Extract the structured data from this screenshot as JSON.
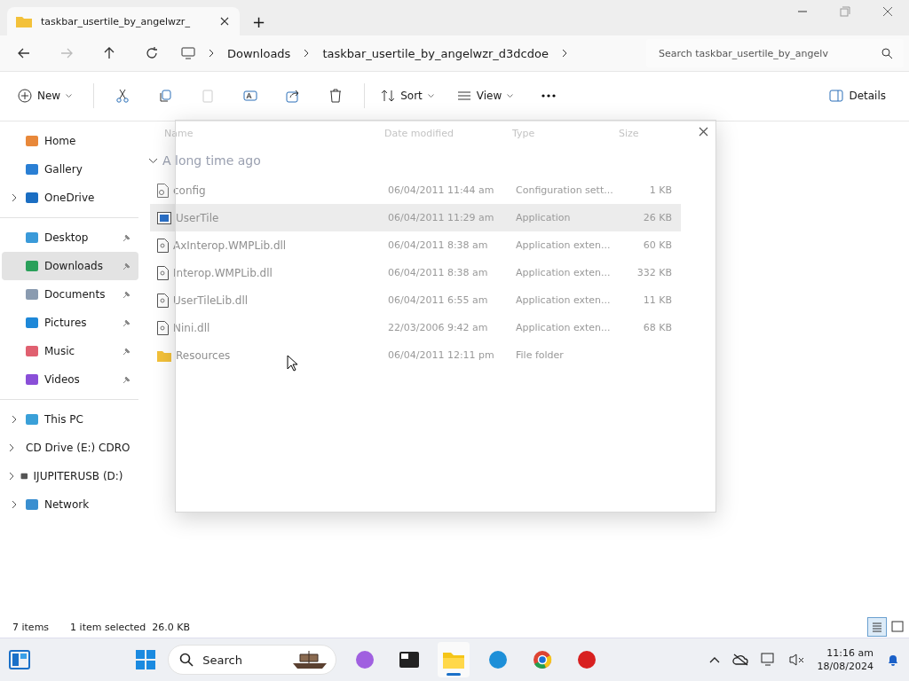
{
  "window": {
    "tab_title": "taskbar_usertile_by_angelwzr_",
    "new_tab": "+"
  },
  "address": {
    "crumbs": [
      "Downloads",
      "taskbar_usertile_by_angelwzr_d3dcdoe"
    ],
    "search_placeholder": "Search taskbar_usertile_by_angelv"
  },
  "toolbar": {
    "new": "New",
    "sort": "Sort",
    "view": "View",
    "details": "Details"
  },
  "sidebar": {
    "groups": [
      [
        {
          "label": "Home",
          "kind": "home",
          "expandable": false,
          "pinned": false,
          "selected": false
        },
        {
          "label": "Gallery",
          "kind": "gallery",
          "expandable": false,
          "pinned": false,
          "selected": false
        },
        {
          "label": "OneDrive",
          "kind": "cloud",
          "expandable": true,
          "pinned": false,
          "selected": false
        }
      ],
      [
        {
          "label": "Desktop",
          "kind": "desktop",
          "expandable": false,
          "pinned": true,
          "selected": false
        },
        {
          "label": "Downloads",
          "kind": "download",
          "expandable": false,
          "pinned": true,
          "selected": true
        },
        {
          "label": "Documents",
          "kind": "document",
          "expandable": false,
          "pinned": true,
          "selected": false
        },
        {
          "label": "Pictures",
          "kind": "pictures",
          "expandable": false,
          "pinned": true,
          "selected": false
        },
        {
          "label": "Music",
          "kind": "music",
          "expandable": false,
          "pinned": true,
          "selected": false
        },
        {
          "label": "Videos",
          "kind": "videos",
          "expandable": false,
          "pinned": true,
          "selected": false
        }
      ],
      [
        {
          "label": "This PC",
          "kind": "pc",
          "expandable": true,
          "pinned": false,
          "selected": false
        },
        {
          "label": "CD Drive (E:) CDRO",
          "kind": "drive",
          "expandable": true,
          "pinned": false,
          "selected": false
        },
        {
          "label": "IJUPITERUSB (D:)",
          "kind": "drive",
          "expandable": true,
          "pinned": false,
          "selected": false
        },
        {
          "label": "Network",
          "kind": "network",
          "expandable": true,
          "pinned": false,
          "selected": false
        }
      ]
    ]
  },
  "file_list": {
    "columns": [
      "Name",
      "Date modified",
      "Type",
      "Size"
    ],
    "group": "A long time ago",
    "rows": [
      {
        "name": "config",
        "date": "06/04/2011 11:44 am",
        "type": "Configuration sett...",
        "size": "1 KB",
        "kind": "config",
        "selected": false
      },
      {
        "name": "UserTile",
        "date": "06/04/2011 11:29 am",
        "type": "Application",
        "size": "26 KB",
        "kind": "app",
        "selected": true
      },
      {
        "name": "AxInterop.WMPLib.dll",
        "date": "06/04/2011 8:38 am",
        "type": "Application exten...",
        "size": "60 KB",
        "kind": "dll",
        "selected": false
      },
      {
        "name": "Interop.WMPLib.dll",
        "date": "06/04/2011 8:38 am",
        "type": "Application exten...",
        "size": "332 KB",
        "kind": "dll",
        "selected": false
      },
      {
        "name": "UserTileLib.dll",
        "date": "06/04/2011 6:55 am",
        "type": "Application exten...",
        "size": "11 KB",
        "kind": "dll",
        "selected": false
      },
      {
        "name": "Nini.dll",
        "date": "22/03/2006 9:42 am",
        "type": "Application exten...",
        "size": "68 KB",
        "kind": "dll",
        "selected": false
      },
      {
        "name": "Resources",
        "date": "06/04/2011 12:11 pm",
        "type": "File folder",
        "kind": "folder",
        "selected": false
      }
    ]
  },
  "status_bar": {
    "count": "7 items",
    "selection": "1 item selected  26.0 KB"
  },
  "taskbar": {
    "search": "Search",
    "apps": [
      {
        "kind": "copilot",
        "selected": false
      },
      {
        "kind": "terminal",
        "selected": false
      },
      {
        "kind": "explorer",
        "selected": true
      },
      {
        "kind": "edge",
        "selected": false
      },
      {
        "kind": "chrome",
        "selected": false
      },
      {
        "kind": "paint",
        "selected": false
      }
    ],
    "time": "11:16 am",
    "date": "18/08/2024"
  }
}
